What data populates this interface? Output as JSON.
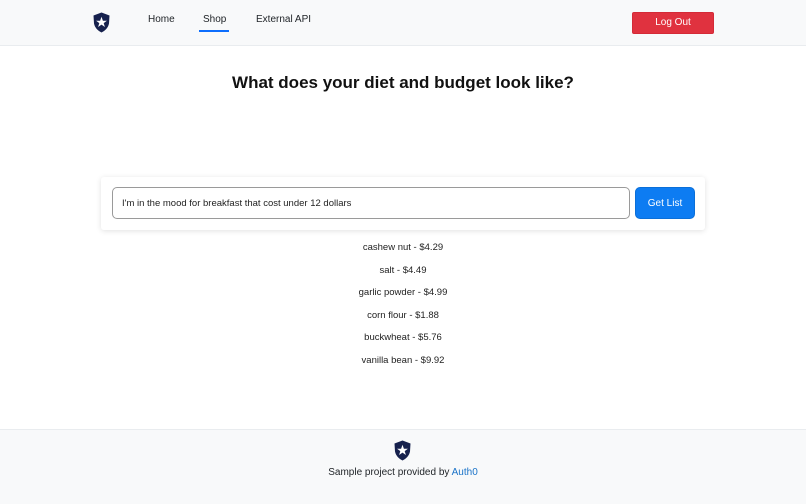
{
  "nav": {
    "logo_icon": "auth0-shield-star-icon",
    "links": [
      {
        "label": "Home"
      },
      {
        "label": "Shop",
        "active": true
      },
      {
        "label": "External API"
      }
    ],
    "logout_label": "Log Out"
  },
  "main": {
    "title": "What does your diet and budget look like?",
    "search": {
      "value": "I'm in the mood for breakfast that cost under 12 dollars",
      "button_label": "Get List"
    },
    "results": [
      "cashew nut - $4.29",
      "salt - $4.49",
      "garlic powder - $4.99",
      "corn flour - $1.88",
      "buckwheat - $5.76",
      "vanilla bean - $9.92"
    ]
  },
  "footer": {
    "logo_icon": "auth0-shield-star-icon",
    "text": "Sample project provided by ",
    "link_label": "Auth0"
  },
  "colors": {
    "accent_blue": "#0d7cf2",
    "logout_red": "#e0323f",
    "link_blue": "#1a73c8",
    "nav_bg": "#f8f9fa"
  }
}
